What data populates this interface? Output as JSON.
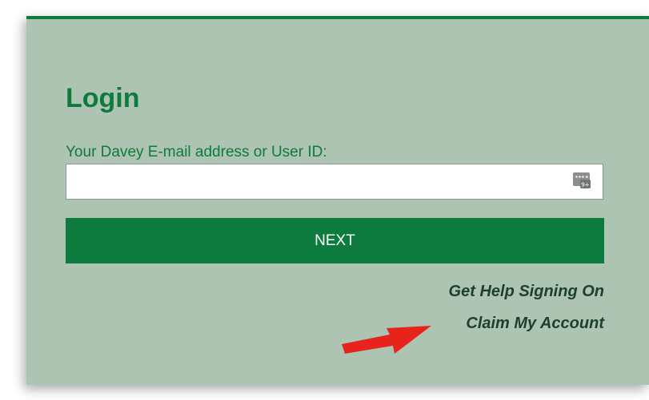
{
  "login": {
    "title": "Login",
    "email_label": "Your Davey E-mail address or User ID:",
    "email_value": "",
    "next_label": "NEXT",
    "help_link": "Get Help Signing On",
    "claim_link": "Claim My Account"
  },
  "icons": {
    "autofill": "password-manager-autofill-icon",
    "annotation": "red-arrow-icon"
  },
  "colors": {
    "brand_green": "#0d7a3e",
    "panel_background": "#adc4b2",
    "link_text": "#1e3f2c",
    "arrow_red": "#e8231c"
  }
}
